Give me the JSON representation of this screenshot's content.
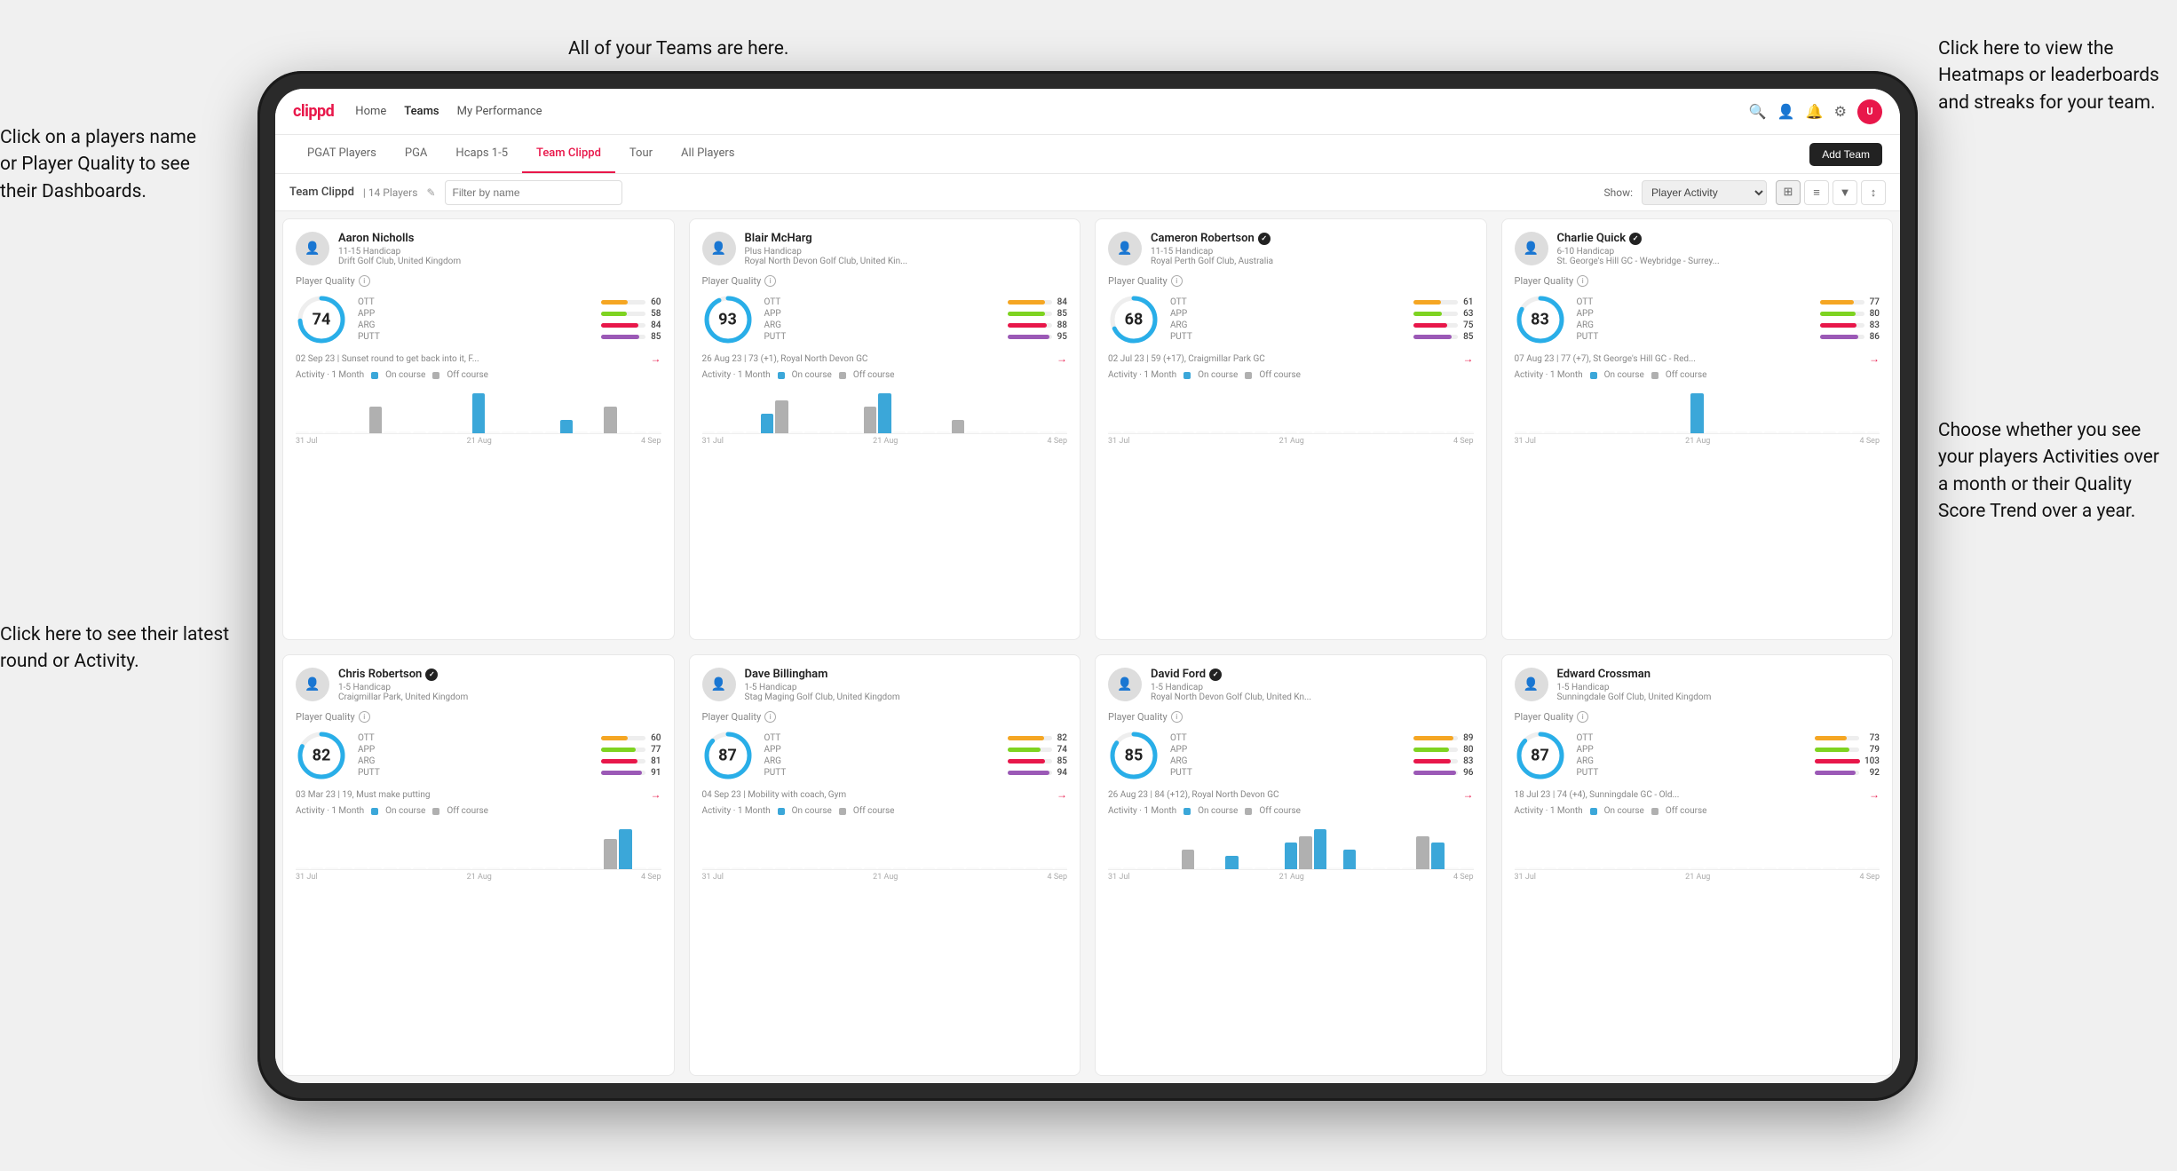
{
  "annotations": {
    "teams_here": "All of your Teams are here.",
    "heatmaps": "Click here to view the\nHeatmaps or leaderboards\nand streaks for your team.",
    "click_name": "Click on a players name\nor Player Quality to see\ntheir Dashboards.",
    "latest_round": "Click here to see their latest\nround or Activity.",
    "choose_activity": "Choose whether you see\nyour players Activities over\na month or their Quality\nScore Trend over a year."
  },
  "nav": {
    "logo": "clippd",
    "links": [
      "Home",
      "Teams",
      "My Performance"
    ],
    "icons": [
      "search",
      "person",
      "bell",
      "settings",
      "avatar"
    ]
  },
  "sub_nav": {
    "tabs": [
      "PGAT Players",
      "PGA",
      "Hcaps 1-5",
      "Team Clippd",
      "Tour",
      "All Players"
    ],
    "active_tab": "Team Clippd",
    "add_team_label": "Add Team"
  },
  "team_header": {
    "title": "Team Clippd",
    "separator": "|",
    "count": "14 Players",
    "search_placeholder": "Filter by name",
    "show_label": "Show:",
    "show_option": "Player Activity",
    "view_options": [
      "grid-2",
      "grid-3",
      "filter",
      "sort"
    ]
  },
  "players": [
    {
      "name": "Aaron Nicholls",
      "handicap": "11-15 Handicap",
      "club": "Drift Golf Club, United Kingdom",
      "verified": false,
      "quality": 74,
      "ott": 60,
      "app": 58,
      "arg": 84,
      "putt": 85,
      "recent_date": "02 Sep 23",
      "recent_text": "Sunset round to get back into it, F...",
      "bars": [
        0,
        0,
        0,
        0,
        0,
        2,
        0,
        0,
        0,
        0,
        0,
        0,
        3,
        0,
        0,
        0,
        0,
        0,
        1,
        0,
        0,
        2,
        0,
        0,
        0
      ]
    },
    {
      "name": "Blair McHarg",
      "handicap": "Plus Handicap",
      "club": "Royal North Devon Golf Club, United Kin...",
      "verified": false,
      "quality": 93,
      "ott": 84,
      "app": 85,
      "arg": 88,
      "putt": 95,
      "recent_date": "26 Aug 23",
      "recent_text": "73 (+1), Royal North Devon GC",
      "bars": [
        0,
        0,
        0,
        0,
        3,
        5,
        0,
        0,
        0,
        0,
        0,
        4,
        6,
        0,
        0,
        0,
        0,
        2,
        0,
        0,
        0,
        0,
        0,
        0,
        0
      ]
    },
    {
      "name": "Cameron Robertson",
      "handicap": "11-15 Handicap",
      "club": "Royal Perth Golf Club, Australia",
      "verified": true,
      "quality": 68,
      "ott": 61,
      "app": 63,
      "arg": 75,
      "putt": 85,
      "recent_date": "02 Jul 23",
      "recent_text": "59 (+17), Craigmillar Park GC",
      "bars": [
        0,
        0,
        0,
        0,
        0,
        0,
        0,
        0,
        0,
        0,
        0,
        0,
        0,
        0,
        0,
        0,
        0,
        0,
        0,
        0,
        0,
        0,
        0,
        0,
        0
      ]
    },
    {
      "name": "Charlie Quick",
      "handicap": "6-10 Handicap",
      "club": "St. George's Hill GC - Weybridge - Surrey...",
      "verified": true,
      "quality": 83,
      "ott": 77,
      "app": 80,
      "arg": 83,
      "putt": 86,
      "recent_date": "07 Aug 23",
      "recent_text": "77 (+7), St George's Hill GC - Red...",
      "bars": [
        0,
        0,
        0,
        0,
        0,
        0,
        0,
        0,
        0,
        0,
        0,
        0,
        3,
        0,
        0,
        0,
        0,
        0,
        0,
        0,
        0,
        0,
        0,
        0,
        0
      ]
    },
    {
      "name": "Chris Robertson",
      "handicap": "1-5 Handicap",
      "club": "Craigmillar Park, United Kingdom",
      "verified": true,
      "quality": 82,
      "ott": 60,
      "app": 77,
      "arg": 81,
      "putt": 91,
      "recent_date": "03 Mar 23",
      "recent_text": "19, Must make putting",
      "bars": [
        0,
        0,
        0,
        0,
        0,
        0,
        0,
        0,
        0,
        0,
        0,
        0,
        0,
        0,
        0,
        0,
        0,
        0,
        0,
        0,
        0,
        3,
        4,
        0,
        0
      ]
    },
    {
      "name": "Dave Billingham",
      "handicap": "1-5 Handicap",
      "club": "Stag Maging Golf Club, United Kingdom",
      "verified": false,
      "quality": 87,
      "ott": 82,
      "app": 74,
      "arg": 85,
      "putt": 94,
      "recent_date": "04 Sep 23",
      "recent_text": "Mobility with coach, Gym",
      "bars": [
        0,
        0,
        0,
        0,
        0,
        0,
        0,
        0,
        0,
        0,
        0,
        0,
        0,
        0,
        0,
        0,
        0,
        0,
        0,
        0,
        0,
        0,
        0,
        0,
        0
      ]
    },
    {
      "name": "David Ford",
      "handicap": "1-5 Handicap",
      "club": "Royal North Devon Golf Club, United Kn...",
      "verified": true,
      "quality": 85,
      "ott": 89,
      "app": 80,
      "arg": 83,
      "putt": 96,
      "recent_date": "26 Aug 23",
      "recent_text": "84 (+12), Royal North Devon GC",
      "bars": [
        0,
        0,
        0,
        0,
        0,
        3,
        0,
        0,
        2,
        0,
        0,
        0,
        4,
        5,
        6,
        0,
        3,
        0,
        0,
        0,
        0,
        5,
        4,
        0,
        0
      ]
    },
    {
      "name": "Edward Crossman",
      "handicap": "1-5 Handicap",
      "club": "Sunningdale Golf Club, United Kingdom",
      "verified": false,
      "quality": 87,
      "ott": 73,
      "app": 79,
      "arg": 103,
      "putt": 92,
      "recent_date": "18 Jul 23",
      "recent_text": "74 (+4), Sunningdale GC - Old...",
      "bars": [
        0,
        0,
        0,
        0,
        0,
        0,
        0,
        0,
        0,
        0,
        0,
        0,
        0,
        0,
        0,
        0,
        0,
        0,
        0,
        0,
        0,
        0,
        0,
        0,
        0
      ]
    }
  ],
  "chart_dates": [
    "31 Jul",
    "21 Aug",
    "4 Sep"
  ],
  "activity_labels": {
    "period": "Activity · 1 Month",
    "on_course": "On course",
    "off_course": "Off course"
  },
  "stat_colors": {
    "ott": "#f5a623",
    "app": "#7ed321",
    "arg": "#e8174a",
    "putt": "#9b59b6"
  },
  "circle_colors": {
    "low": "#4fc3f7",
    "mid": "#29b6f6",
    "high": "#0288d1",
    "accent": "#e8174a"
  }
}
